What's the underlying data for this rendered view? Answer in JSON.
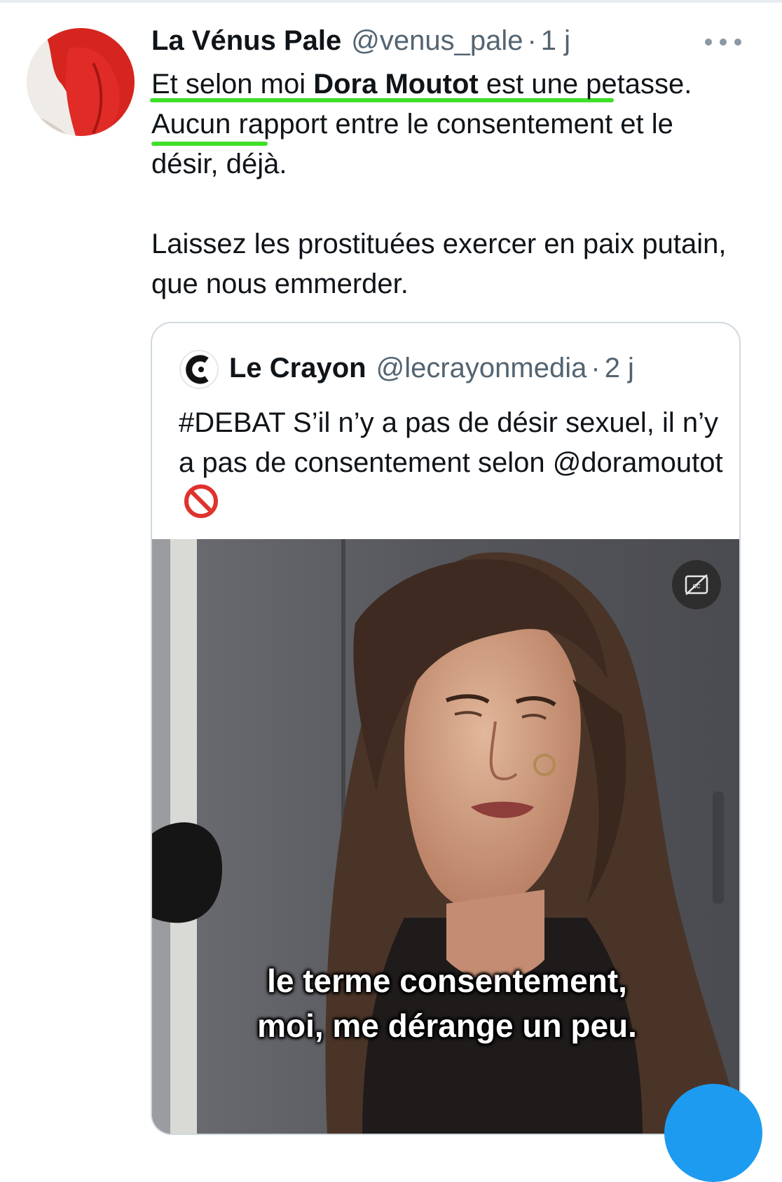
{
  "tweet": {
    "display_name": "La Vénus Pale",
    "handle": "@venus_pale",
    "separator": "·",
    "time": "1 j",
    "body": {
      "line1_pre": "Et selon moi ",
      "line1_bold": "Dora Moutot",
      "line1_post": " est une petasse. Aucun rapport entre le consentement et le désir, déjà.",
      "paragraph2": "Laissez les prostituées exercer en paix putain, que nous emmerder."
    },
    "more_icon": "more-horizontal-icon"
  },
  "quote": {
    "display_name": "Le Crayon",
    "handle": "@lecrayonmedia",
    "separator": "·",
    "time": "2 j",
    "text": "#DEBAT S’il n’y a pas de désir sexuel, il n’y a pas de consentement selon @doramoutot",
    "emoji_icon": "no-entry-sign-icon",
    "video": {
      "subtitle_line1": "le terme consentement,",
      "subtitle_line2": "moi, me dérange un peu.",
      "cc_icon": "closed-captions-off-icon"
    }
  },
  "colors": {
    "highlight": "#3ee02a",
    "secondary_text": "#536471",
    "accent": "#1d9bf0"
  }
}
